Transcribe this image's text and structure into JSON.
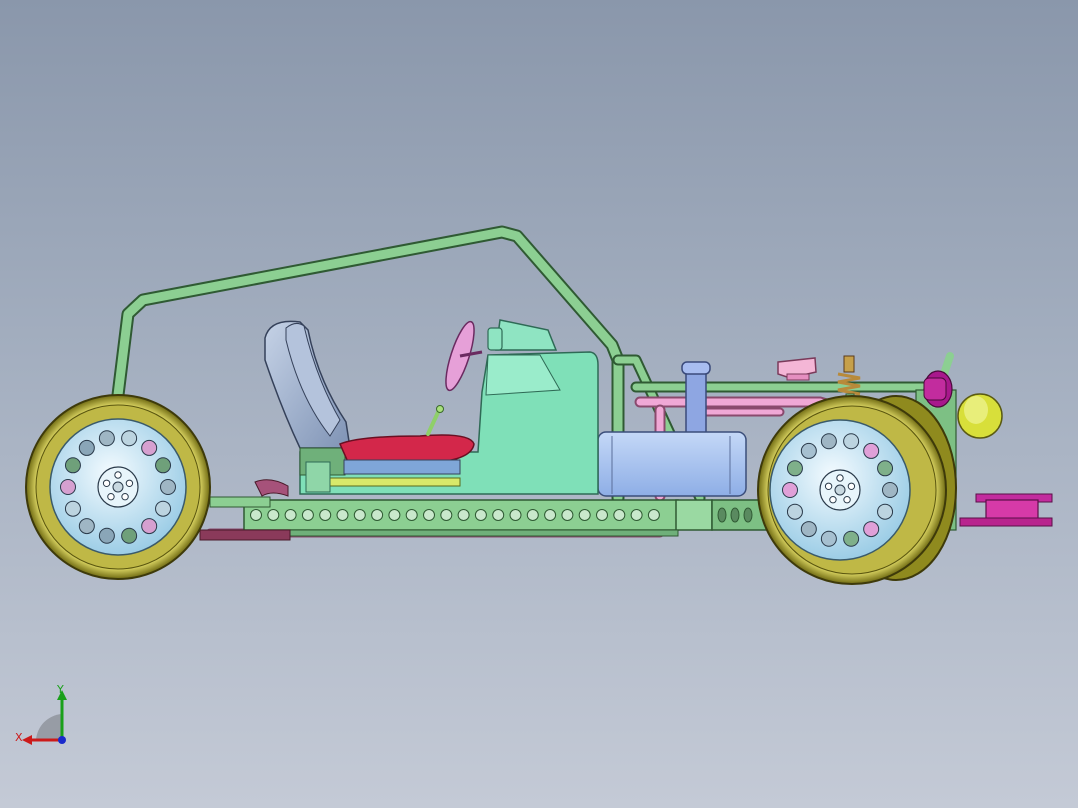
{
  "app": {
    "view": "cad-3d-viewport",
    "model": "buggy-chassis-assembly",
    "projection": "side-view"
  },
  "colors": {
    "background_top": "#8a97ab",
    "background_bottom": "#c4cad6",
    "frame_green": "#7fbf86",
    "frame_outline": "#2f5a33",
    "tire_olive": "#b5b03a",
    "rim_light_blue": "#cfe8f5",
    "seat_blue": "#9fb1cc",
    "seat_cushion_red": "#d3274a",
    "body_panel_mint": "#7fe0b8",
    "fuel_tank_blue": "#a9c6f2",
    "tube_pink": "#eaa0cf",
    "part_magenta": "#c22c9e",
    "headlight_yellow": "#d8df3a",
    "exhaust_maroon": "#8a3a5a"
  },
  "parts": [
    "roll-cage",
    "front-wheel",
    "rear-wheel",
    "seat",
    "seat-cushion",
    "steering-wheel",
    "dashboard-panel",
    "chassis-frame-rail",
    "fuel-tank",
    "shock-absorber",
    "headlight",
    "tow-hitch",
    "exhaust-pipe",
    "gear-shifter"
  ],
  "triad": {
    "x_label": "X",
    "y_label": "Y",
    "x_color": "#cc1a1a",
    "y_color": "#1aa01a",
    "z_color": "#1a2acc"
  }
}
